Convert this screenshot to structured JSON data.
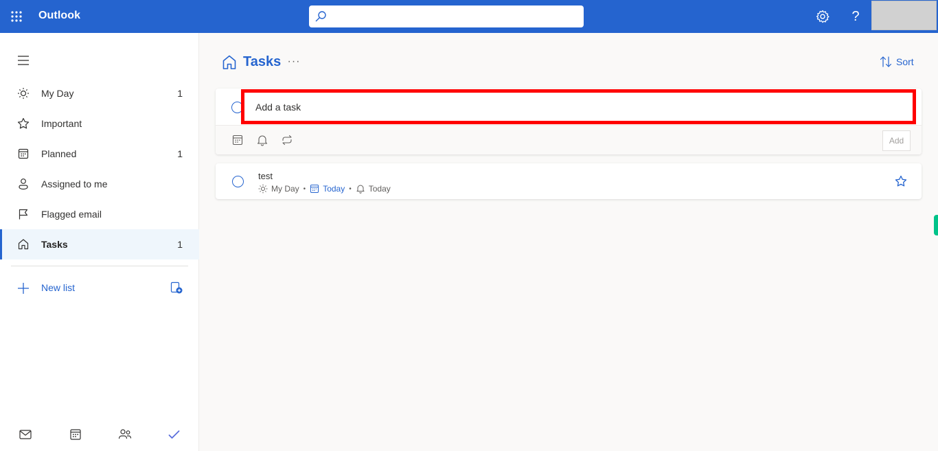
{
  "topbar": {
    "app_name": "Outlook",
    "search_placeholder": "",
    "help_label": "?"
  },
  "sidebar": {
    "items": [
      {
        "label": "My Day",
        "count": "1",
        "icon": "sun-icon"
      },
      {
        "label": "Important",
        "count": "",
        "icon": "star-icon"
      },
      {
        "label": "Planned",
        "count": "1",
        "icon": "calendar-icon"
      },
      {
        "label": "Assigned to me",
        "count": "",
        "icon": "person-icon"
      },
      {
        "label": "Flagged email",
        "count": "",
        "icon": "flag-icon"
      },
      {
        "label": "Tasks",
        "count": "1",
        "icon": "home-icon",
        "active": true
      }
    ],
    "new_list_label": "New list",
    "bottom_apps": [
      "mail-icon",
      "calendar-icon",
      "people-icon",
      "todo-check-icon"
    ]
  },
  "main": {
    "title": "Tasks",
    "more_label": "···",
    "sort_label": "Sort",
    "add_task": {
      "placeholder": "Add a task",
      "value": "",
      "add_button_label": "Add"
    },
    "tasks": [
      {
        "title": "test",
        "meta": [
          {
            "icon": "sun-icon",
            "text": "My Day",
            "highlight": false
          },
          {
            "icon": "calendar-icon",
            "text": "Today",
            "highlight": true
          },
          {
            "icon": "bell-icon",
            "text": "Today",
            "highlight": false
          }
        ],
        "important": false
      }
    ]
  },
  "colors": {
    "brand": "#2564cf",
    "highlight_box": "#ff0000",
    "side_tab": "#00c389"
  }
}
